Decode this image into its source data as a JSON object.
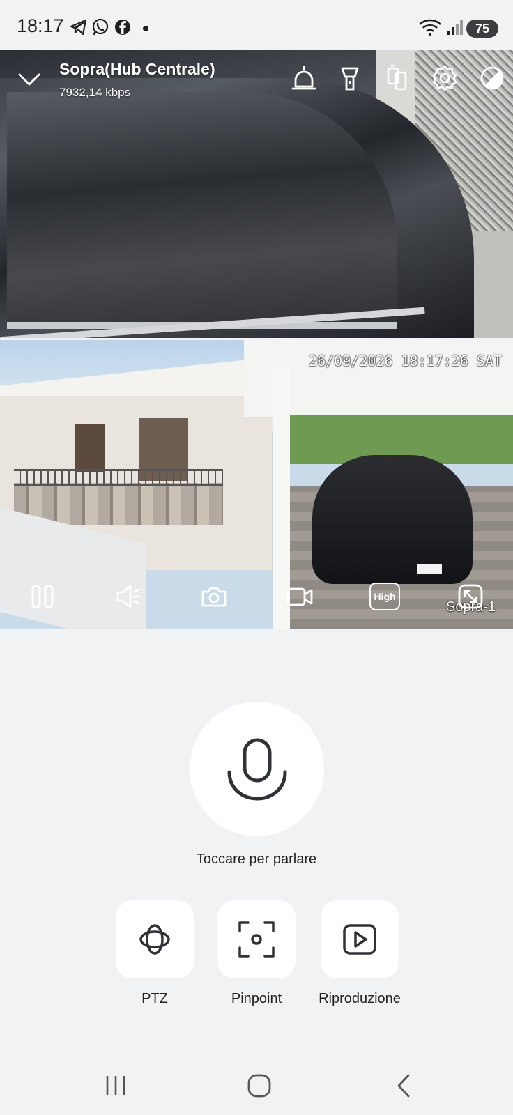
{
  "status_bar": {
    "time": "18:17",
    "notifications": [
      "telegram-icon",
      "whatsapp-icon",
      "facebook-icon",
      "dot-icon"
    ],
    "battery": "75"
  },
  "camera": {
    "title": "Sopra(Hub Centrale)",
    "bitrate": "7932,14 kbps",
    "timestamp": "26/09/2026 18:17:26 SAT",
    "camera_name": "Sopra-1",
    "quality_label": "High",
    "top_actions": [
      "alarm-bell-icon",
      "spotlight-icon",
      "battery-devices-icon",
      "settings-icon",
      "contrast-icon"
    ],
    "controls": [
      "pause-icon",
      "speaker-icon",
      "snapshot-icon",
      "record-icon",
      "quality-icon",
      "fullscreen-icon"
    ]
  },
  "talk": {
    "label": "Toccare per parlare"
  },
  "features": [
    {
      "label": "PTZ",
      "icon": "ptz-icon"
    },
    {
      "label": "Pinpoint",
      "icon": "pinpoint-icon"
    },
    {
      "label": "Riproduzione",
      "icon": "playback-icon"
    }
  ],
  "nav": [
    "recent-apps-icon",
    "home-icon",
    "back-icon"
  ],
  "colors": {
    "background": "#f1f2f4",
    "tile": "#ffffff",
    "icon": "#2f3237"
  }
}
